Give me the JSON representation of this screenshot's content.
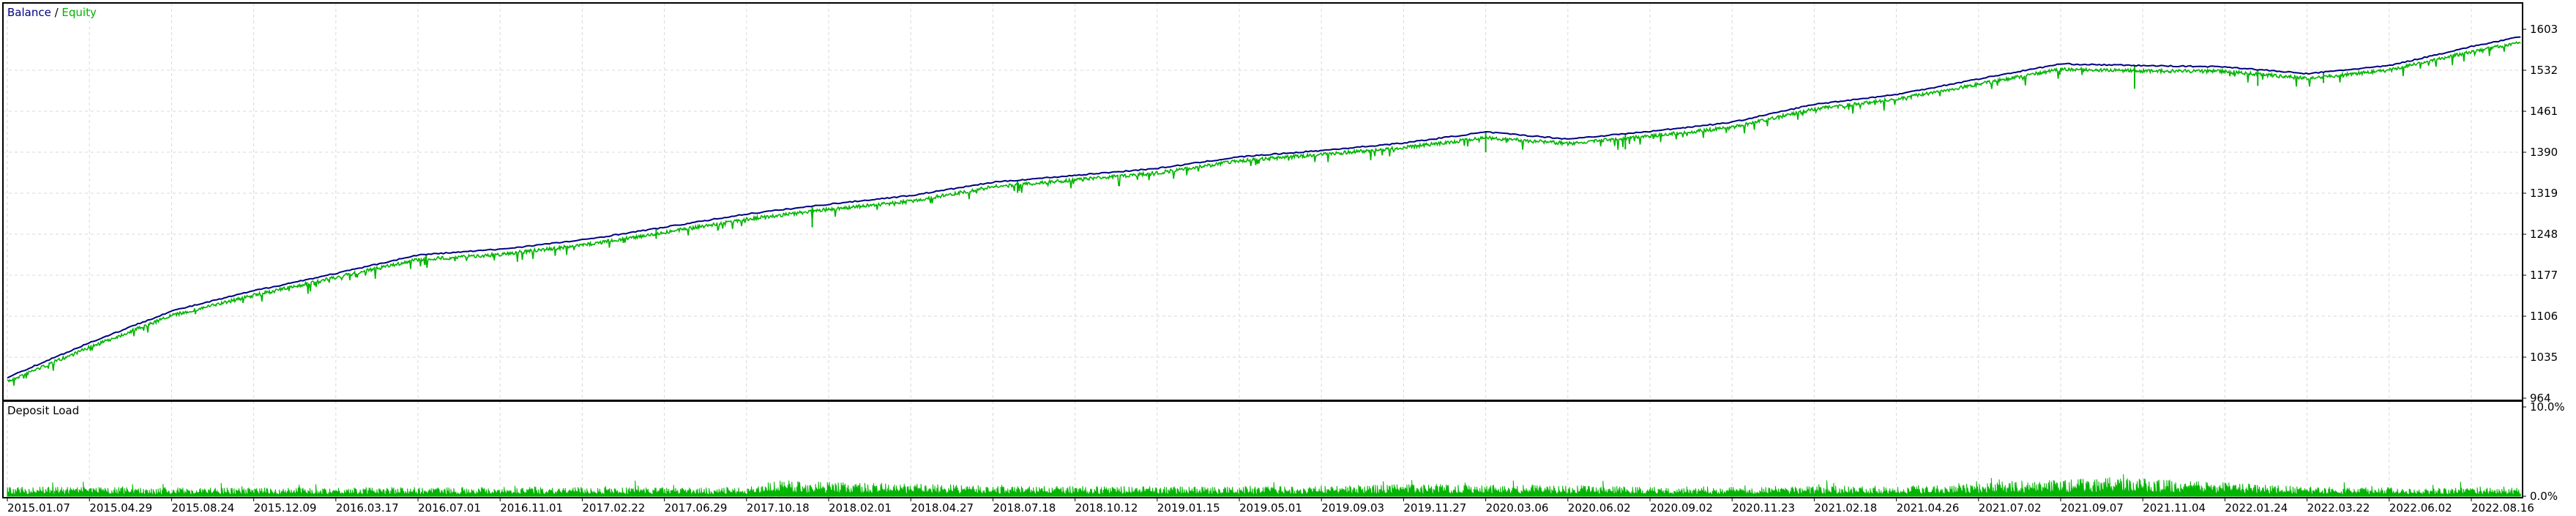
{
  "chart_data": [
    {
      "type": "line",
      "legend": {
        "balance_label": "Balance",
        "separator": " / ",
        "equity_label": "Equity",
        "placement": "top-left"
      },
      "colors": {
        "balance": "#000080",
        "equity": "#00b400",
        "grid": "#d8d8d8",
        "frame": "#000000"
      },
      "ylim": [
        964,
        1640
      ],
      "y_ticks": [
        "1603",
        "1532",
        "1461",
        "1390",
        "1319",
        "1248",
        "1177",
        "1106",
        "1035",
        "964"
      ],
      "y_tick_values": [
        1603,
        1532,
        1461,
        1390,
        1319,
        1248,
        1177,
        1106,
        1035,
        964
      ],
      "x_ticks": [
        "2015.01.07",
        "2015.04.29",
        "2015.08.24",
        "2015.12.09",
        "2016.03.17",
        "2016.07.01",
        "2016.11.01",
        "2017.02.22",
        "2017.06.29",
        "2017.10.18",
        "2018.02.01",
        "2018.04.27",
        "2018.07.18",
        "2018.10.12",
        "2019.01.15",
        "2019.05.01",
        "2019.09.03",
        "2019.11.27",
        "2020.03.06",
        "2020.06.02",
        "2020.09.02",
        "2020.11.23",
        "2021.02.18",
        "2021.04.26",
        "2021.07.02",
        "2021.09.07",
        "2021.11.04",
        "2022.01.24",
        "2022.03.22",
        "2022.06.02",
        "2022.08.16"
      ],
      "grid": true,
      "series": [
        {
          "name": "Balance",
          "x": [
            0,
            1,
            2,
            3,
            4,
            5,
            6,
            7,
            8,
            9,
            10,
            11,
            12,
            13,
            14,
            15,
            16,
            17,
            18,
            19,
            20,
            21,
            22,
            23,
            24,
            25,
            26,
            27,
            28,
            29,
            30,
            30.6
          ],
          "values": [
            1000,
            1060,
            1115,
            1150,
            1180,
            1212,
            1222,
            1238,
            1260,
            1283,
            1300,
            1315,
            1338,
            1350,
            1362,
            1382,
            1393,
            1406,
            1425,
            1413,
            1426,
            1442,
            1473,
            1490,
            1517,
            1543,
            1540,
            1538,
            1526,
            1540,
            1573,
            1590
          ]
        },
        {
          "name": "Equity",
          "x": [
            0,
            1,
            2,
            3,
            4,
            5,
            6,
            7,
            8,
            9,
            10,
            11,
            12,
            13,
            14,
            15,
            16,
            17,
            18,
            19,
            20,
            21,
            22,
            23,
            24,
            25,
            26,
            27,
            28,
            29,
            30,
            30.6
          ],
          "values": [
            996,
            1055,
            1110,
            1145,
            1176,
            1207,
            1216,
            1232,
            1254,
            1277,
            1294,
            1308,
            1333,
            1345,
            1357,
            1378,
            1389,
            1401,
            1418,
            1408,
            1421,
            1436,
            1468,
            1485,
            1511,
            1537,
            1534,
            1533,
            1521,
            1535,
            1567,
            1583
          ]
        }
      ],
      "drops": [
        {
          "x": 5.1,
          "value": 1195
        },
        {
          "x": 7.9,
          "value": 1240
        },
        {
          "x": 9.8,
          "value": 1260
        },
        {
          "x": 12.3,
          "value": 1320
        },
        {
          "x": 18.0,
          "value": 1390
        },
        {
          "x": 19.7,
          "value": 1395
        },
        {
          "x": 25.9,
          "value": 1500
        },
        {
          "x": 27.4,
          "value": 1505
        },
        {
          "x": 28.2,
          "value": 1510
        }
      ]
    },
    {
      "type": "bar",
      "title": "Deposit Load",
      "ylim": [
        0,
        10
      ],
      "y_ticks": [
        "10.0%",
        "0.0%"
      ],
      "y_tick_values": [
        10,
        0
      ],
      "color": "#00b400",
      "profile_x": [
        0,
        3,
        6,
        9,
        9.3,
        12,
        15,
        17.6,
        20,
        23,
        25.7,
        28,
        30.6
      ],
      "profile_values": [
        0.9,
        0.8,
        0.9,
        0.8,
        1.5,
        1.0,
        0.9,
        1.2,
        0.9,
        1.0,
        1.8,
        0.9,
        0.8
      ]
    }
  ]
}
